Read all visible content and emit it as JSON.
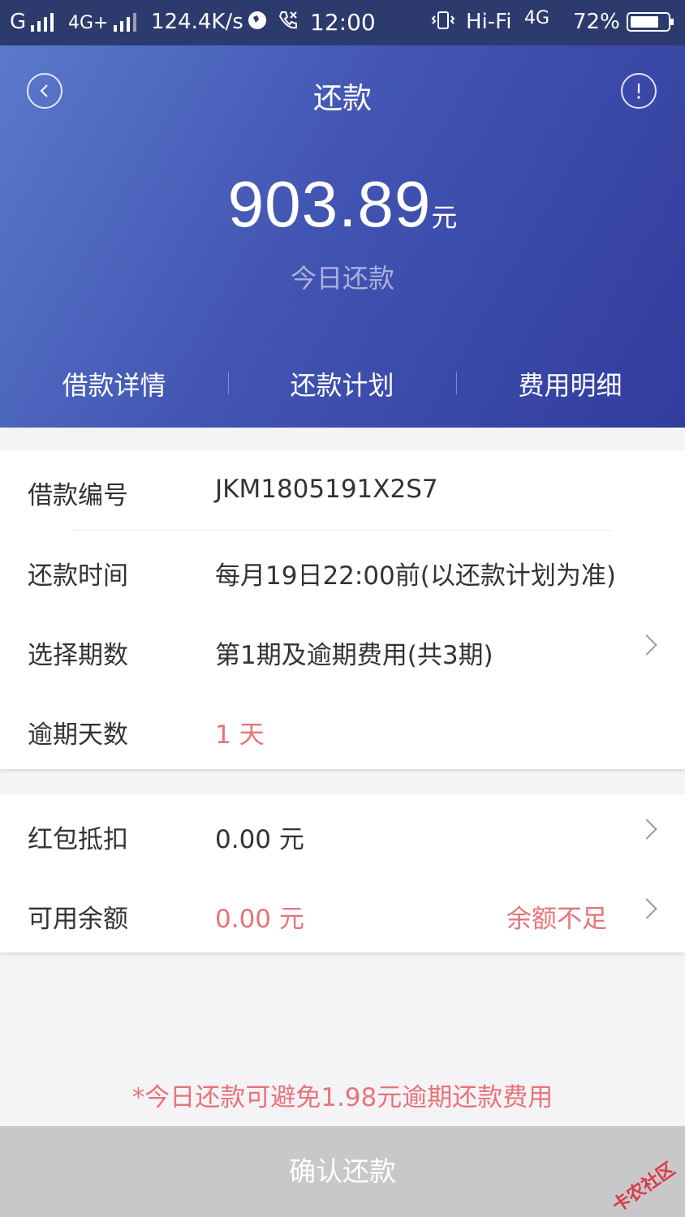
{
  "status_bar": {
    "carrier1": "G",
    "net1": "4G+",
    "speed": "124.4K/s",
    "time": "12:00",
    "hifi": "Hi-Fi",
    "net2": "4G",
    "battery": "72%"
  },
  "header": {
    "title": "还款",
    "amount": "903.89",
    "amount_unit": "元",
    "amount_label": "今日还款",
    "tabs": [
      "借款详情",
      "还款计划",
      "费用明细"
    ]
  },
  "loan_card": {
    "rows": [
      {
        "label": "借款编号",
        "value": "JKM1805191X2S7"
      },
      {
        "label": "还款时间",
        "value": "每月19日22:00前(以还款计划为准)"
      },
      {
        "label": "选择期数",
        "value": "第1期及逾期费用(共3期)"
      },
      {
        "label": "逾期天数",
        "value": "1 天"
      }
    ]
  },
  "payment_card": {
    "rows": [
      {
        "label": "红包抵扣",
        "value": "0.00 元"
      },
      {
        "label": "可用余额",
        "value": "0.00 元",
        "status": "余额不足"
      }
    ]
  },
  "notice": "*今日还款可避免1.98元逾期还款费用",
  "confirm_button": "确认还款",
  "watermark": "卡农社区",
  "colors": {
    "header_start": "#5a79cc",
    "header_end": "#323c9e",
    "warning_red": "#e8737a",
    "button_disabled": "#c8c8ca"
  }
}
